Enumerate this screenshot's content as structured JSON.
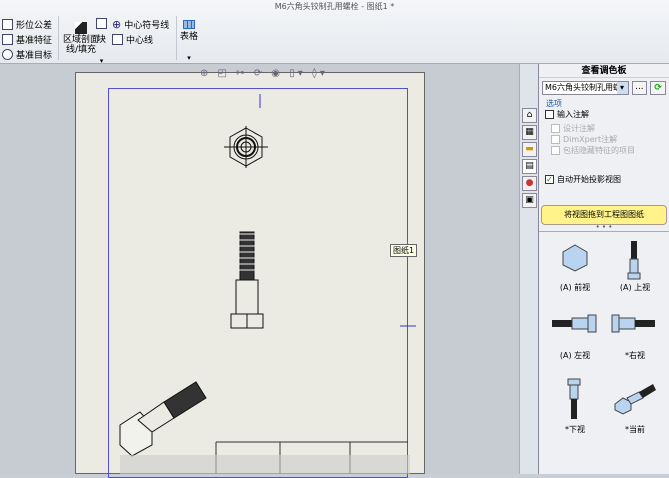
{
  "window": {
    "title": "M6六角头铰制孔用螺栓 - 图纸1 *"
  },
  "ribbon": {
    "annotation_items": [
      "形位公差",
      "基准特征",
      "基准目标"
    ],
    "hatch_label": "区域剖面线/填充",
    "block_label": "块",
    "center_mark_label": "中心符号线",
    "centerline_label": "中心线",
    "table_label": "表格"
  },
  "canvas": {
    "sheet_tooltip": "图纸1"
  },
  "panel": {
    "title": "查看调色板",
    "model_select": "M6六角头铰制孔用螺",
    "browse_label": "...",
    "options_label": "选项",
    "options": [
      {
        "label": "输入注解",
        "checked": false,
        "enabled": true
      },
      {
        "label": "设计注解",
        "checked": false,
        "enabled": false
      },
      {
        "label": "DimXpert注解",
        "checked": false,
        "enabled": false
      },
      {
        "label": "包括隐藏特征的项目",
        "checked": false,
        "enabled": false
      },
      {
        "label": "自动开始投影视图",
        "checked": true,
        "enabled": true
      }
    ],
    "drag_hint": "将视图拖到工程图图纸",
    "views": [
      "(A) 前视",
      "(A) 上视",
      "(A) 左视",
      "*右视",
      "*下视",
      "*当前"
    ]
  }
}
